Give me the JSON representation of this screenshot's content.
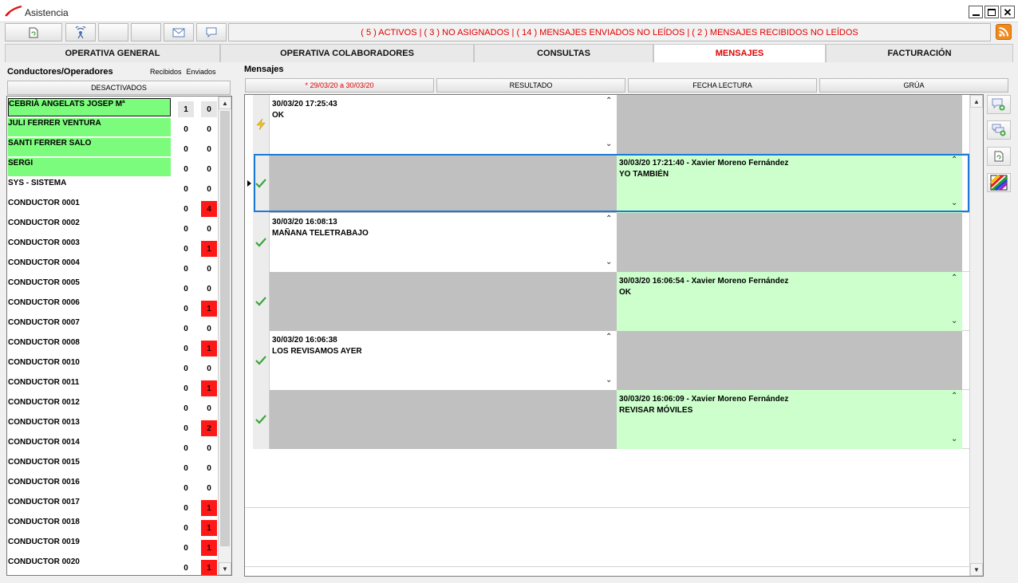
{
  "window": {
    "title": "Asistencia"
  },
  "toolbar": {
    "status_text": "( 5 ) ACTIVOS | ( 3 ) NO ASIGNADOS | ( 14 ) MENSAJES ENVIADOS NO LEÍDOS | ( 2 ) MENSAJES RECIBIDOS NO LEÍDOS",
    "icons": [
      "refresh-icon",
      "radio-antenna-icon",
      "blank-button",
      "blank-button",
      "envelope-icon",
      "speech-bubble-icon"
    ]
  },
  "tabs": [
    {
      "label": "OPERATIVA GENERAL",
      "active": false
    },
    {
      "label": "OPERATIVA COLABORADORES",
      "active": false
    },
    {
      "label": "CONSULTAS",
      "active": false
    },
    {
      "label": "MENSAJES",
      "active": true
    },
    {
      "label": "FACTURACIÓN",
      "active": false
    }
  ],
  "left_panel": {
    "title": "Conductores/Operadores",
    "col_received": "Recibidos",
    "col_sent": "Enviados",
    "deactivated_button": "DESACTIVADOS",
    "drivers": [
      {
        "name": "CEBRIÀ ANGELATS JOSEP Mª",
        "received": "1",
        "sent": "0",
        "green": true,
        "sent_red": false,
        "selected": true
      },
      {
        "name": "JULI FERRER VENTURA",
        "received": "0",
        "sent": "0",
        "green": true,
        "sent_red": false
      },
      {
        "name": "SANTI FERRER SALO",
        "received": "0",
        "sent": "0",
        "green": true,
        "sent_red": false
      },
      {
        "name": "SERGI",
        "received": "0",
        "sent": "0",
        "green": true,
        "sent_red": false
      },
      {
        "name": "SYS - SISTEMA",
        "received": "0",
        "sent": "0",
        "green": false,
        "sent_red": false
      },
      {
        "name": "CONDUCTOR 0001",
        "received": "0",
        "sent": "4",
        "green": false,
        "sent_red": true
      },
      {
        "name": "CONDUCTOR 0002",
        "received": "0",
        "sent": "0",
        "green": false,
        "sent_red": false
      },
      {
        "name": "CONDUCTOR 0003",
        "received": "0",
        "sent": "1",
        "green": false,
        "sent_red": true
      },
      {
        "name": "CONDUCTOR 0004",
        "received": "0",
        "sent": "0",
        "green": false,
        "sent_red": false
      },
      {
        "name": "CONDUCTOR 0005",
        "received": "0",
        "sent": "0",
        "green": false,
        "sent_red": false
      },
      {
        "name": "CONDUCTOR 0006",
        "received": "0",
        "sent": "1",
        "green": false,
        "sent_red": true
      },
      {
        "name": "CONDUCTOR 0007",
        "received": "0",
        "sent": "0",
        "green": false,
        "sent_red": false
      },
      {
        "name": "CONDUCTOR 0008",
        "received": "0",
        "sent": "1",
        "green": false,
        "sent_red": true
      },
      {
        "name": "CONDUCTOR 0010",
        "received": "0",
        "sent": "0",
        "green": false,
        "sent_red": false
      },
      {
        "name": "CONDUCTOR 0011",
        "received": "0",
        "sent": "1",
        "green": false,
        "sent_red": true
      },
      {
        "name": "CONDUCTOR 0012",
        "received": "0",
        "sent": "0",
        "green": false,
        "sent_red": false
      },
      {
        "name": "CONDUCTOR 0013",
        "received": "0",
        "sent": "2",
        "green": false,
        "sent_red": true
      },
      {
        "name": "CONDUCTOR 0014",
        "received": "0",
        "sent": "0",
        "green": false,
        "sent_red": false
      },
      {
        "name": "CONDUCTOR 0015",
        "received": "0",
        "sent": "0",
        "green": false,
        "sent_red": false
      },
      {
        "name": "CONDUCTOR 0016",
        "received": "0",
        "sent": "0",
        "green": false,
        "sent_red": false
      },
      {
        "name": "CONDUCTOR 0017",
        "received": "0",
        "sent": "1",
        "green": false,
        "sent_red": true
      },
      {
        "name": "CONDUCTOR 0018",
        "received": "0",
        "sent": "1",
        "green": false,
        "sent_red": true
      },
      {
        "name": "CONDUCTOR 0019",
        "received": "0",
        "sent": "1",
        "green": false,
        "sent_red": true
      },
      {
        "name": "CONDUCTOR 0020",
        "received": "0",
        "sent": "1",
        "green": false,
        "sent_red": true
      }
    ]
  },
  "messages": {
    "title": "Mensajes",
    "headers": [
      {
        "label": "* 29/03/20 a 30/03/20",
        "red": true
      },
      {
        "label": "RESULTADO",
        "red": false
      },
      {
        "label": "FECHA LECTURA",
        "red": false
      },
      {
        "label": "GRÚA",
        "red": false
      }
    ],
    "rows": [
      {
        "status": "lightning",
        "side": "left",
        "header": "30/03/20 17:25:43",
        "text": "OK",
        "selected": false
      },
      {
        "status": "check",
        "side": "right",
        "header": "30/03/20 17:21:40 - Xavier Moreno Fernández",
        "text": "YO TAMBIÉN",
        "selected": true
      },
      {
        "status": "check",
        "side": "left",
        "header": "30/03/20 16:08:13",
        "text": "MAÑANA TELETRABAJO",
        "selected": false
      },
      {
        "status": "check",
        "side": "right",
        "header": "30/03/20 16:06:54 - Xavier Moreno Fernández",
        "text": "OK",
        "selected": false
      },
      {
        "status": "check",
        "side": "left",
        "header": "30/03/20 16:06:38",
        "text": "LOS REVISAMOS AYER",
        "selected": false
      },
      {
        "status": "check",
        "side": "right",
        "header": "30/03/20 16:06:09 - Xavier Moreno Fernández",
        "text": "REVISAR MÓVILES",
        "selected": false
      }
    ]
  },
  "side_tools": [
    "add-message-icon",
    "add-conversation-icon",
    "refresh-icon",
    "color-palette-icon"
  ],
  "colors": {
    "accent_red": "#e00000",
    "driver_green": "#7cfc7c",
    "badge_red": "#ff1818",
    "message_green": "#ccffcc",
    "cell_gray": "#c0c0c0",
    "selection_blue": "#1a7ad6"
  }
}
